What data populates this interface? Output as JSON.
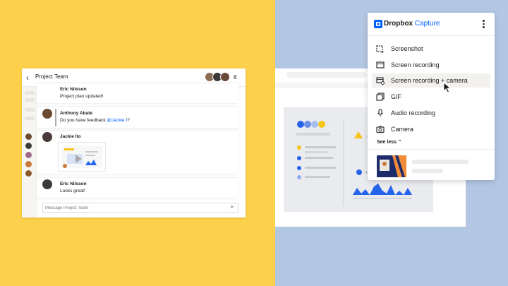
{
  "chat": {
    "title": "Project Team",
    "member_count": "8",
    "messages": [
      {
        "author": "Eric Nilsson",
        "text": "Project plan updated!"
      },
      {
        "author": "Anthony Abate",
        "text_prefix": "Do you have feedback ",
        "mention": "@Jackie I",
        "text_suffix": "?"
      },
      {
        "author": "Jackie Ito",
        "text": ""
      },
      {
        "author": "Eric Nilsson",
        "text": "Looks great!"
      }
    ],
    "composer_placeholder": "Message Project Team"
  },
  "capture_menu": {
    "brand": "Dropbox",
    "product": "Capture",
    "items": [
      {
        "label": "Screenshot",
        "icon": "screenshot-icon"
      },
      {
        "label": "Screen recording",
        "icon": "screen-recording-icon"
      },
      {
        "label": "Screen recording + camera",
        "icon": "screen-camera-icon"
      },
      {
        "label": "GIF",
        "icon": "gif-icon"
      },
      {
        "label": "Audio recording",
        "icon": "microphone-icon"
      },
      {
        "label": "Camera",
        "icon": "camera-icon"
      }
    ],
    "see_less": "See less ⌃"
  },
  "colors": {
    "left_bg": "#fcd04a",
    "right_bg": "#b3c7e3",
    "accent": "#0061fe"
  }
}
